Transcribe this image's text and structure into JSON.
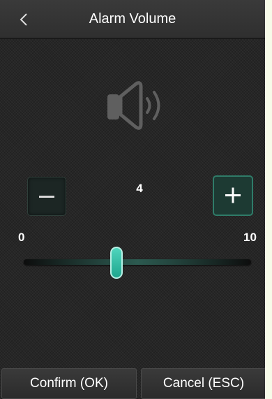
{
  "header": {
    "title": "Alarm Volume",
    "back_icon": "chevron-left-icon"
  },
  "speaker": {
    "icon": "speaker-volume-icon",
    "color": "#5f5f5f"
  },
  "volume": {
    "value": "4",
    "min": "0",
    "max": "10",
    "level": 4,
    "minus_icon": "minus-icon",
    "plus_icon": "plus-icon"
  },
  "footer": {
    "confirm_label": "Confirm (OK)",
    "cancel_label": "Cancel (ESC)"
  },
  "colors": {
    "accent": "#2fb79e",
    "background": "#262626",
    "header": "#353535"
  }
}
